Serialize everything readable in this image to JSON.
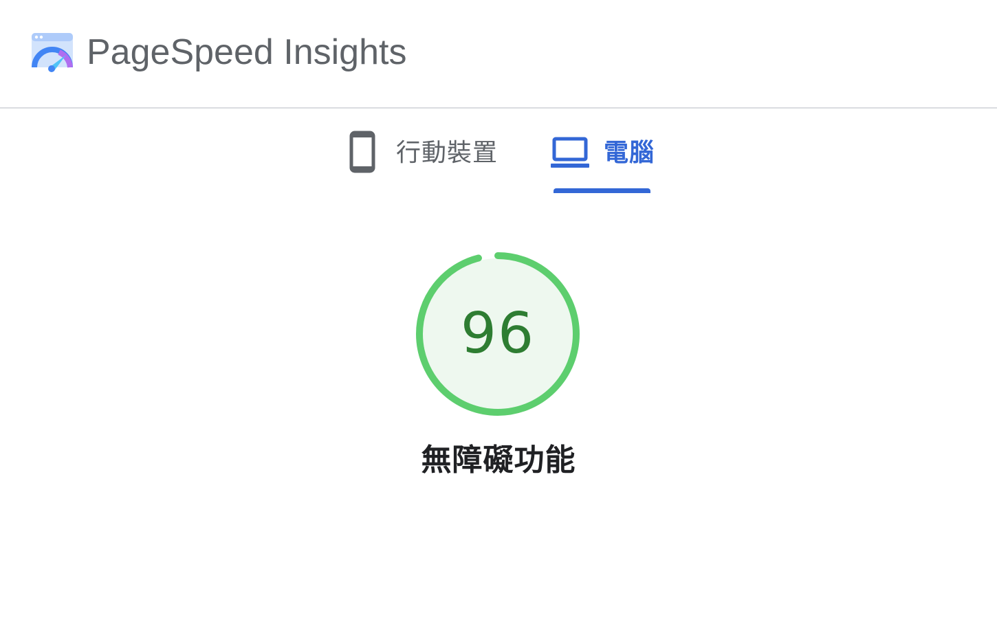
{
  "app": {
    "title": "PageSpeed Insights"
  },
  "tabs": [
    {
      "label": "行動裝置",
      "icon": "smartphone-icon",
      "selected": false
    },
    {
      "label": "電腦",
      "icon": "laptop-icon",
      "selected": true
    }
  ],
  "gauge": {
    "score": "96",
    "value": 96,
    "label": "無障礙功能"
  },
  "colors": {
    "accent": "#3367d6",
    "tab_inactive": "#5f6368",
    "gauge_ring": "#5dce6e",
    "gauge_fill": "#eef8ef",
    "gauge_text": "#2e7d32"
  }
}
